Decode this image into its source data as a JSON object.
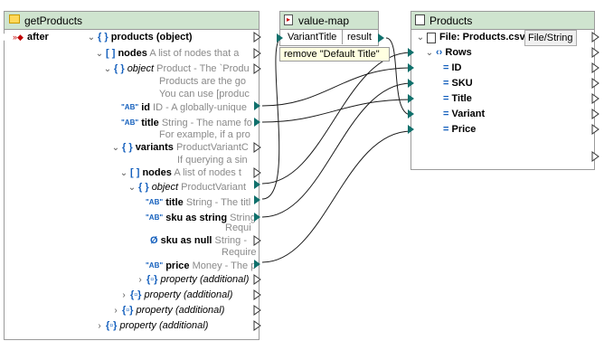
{
  "source": {
    "title": "getProducts",
    "input": "after",
    "rows": [
      {
        "label": "products",
        "type": "(object)"
      },
      {
        "label": "nodes",
        "desc": "A list of nodes that a"
      },
      {
        "label": "object",
        "desc": "Product - The `Produ"
      },
      {
        "desc": "Products are the go"
      },
      {
        "desc": "You can use [produc"
      },
      {
        "label": "id",
        "desc": "ID - A globally-unique"
      },
      {
        "label": "title",
        "desc": "String - The name fo"
      },
      {
        "desc": "For example, if a pro"
      },
      {
        "label": "variants",
        "desc": "ProductVariantC"
      },
      {
        "desc": "If querying a sin"
      },
      {
        "label": "nodes",
        "desc": "A list of nodes t"
      },
      {
        "label": "object",
        "desc": "ProductVariant"
      },
      {
        "label": "title",
        "desc": "String - The titl"
      },
      {
        "label": "sku as string",
        "desc": "String"
      },
      {
        "desc": "Requi"
      },
      {
        "label": "sku as null",
        "desc": "String -"
      },
      {
        "desc": "Require"
      },
      {
        "label": "price",
        "desc": "Money - The p"
      },
      {
        "label": "property (additional)"
      },
      {
        "label": "property (additional)"
      },
      {
        "label": "property (additional)"
      },
      {
        "label": "property (additional)"
      }
    ]
  },
  "valuemap": {
    "title": "value-map",
    "input": "VariantTitle",
    "output": "result",
    "default": "remove \"Default Title\""
  },
  "target": {
    "title": "Products",
    "file_label": "File: Products.csv",
    "file_tag": "File/String",
    "rows_label": "Rows",
    "fields": [
      "ID",
      "SKU",
      "Title",
      "Variant",
      "Price"
    ]
  },
  "colors": {
    "header_bg": "#cfe4cf",
    "connector": "#10706c",
    "type_blue": "#1560bd"
  }
}
